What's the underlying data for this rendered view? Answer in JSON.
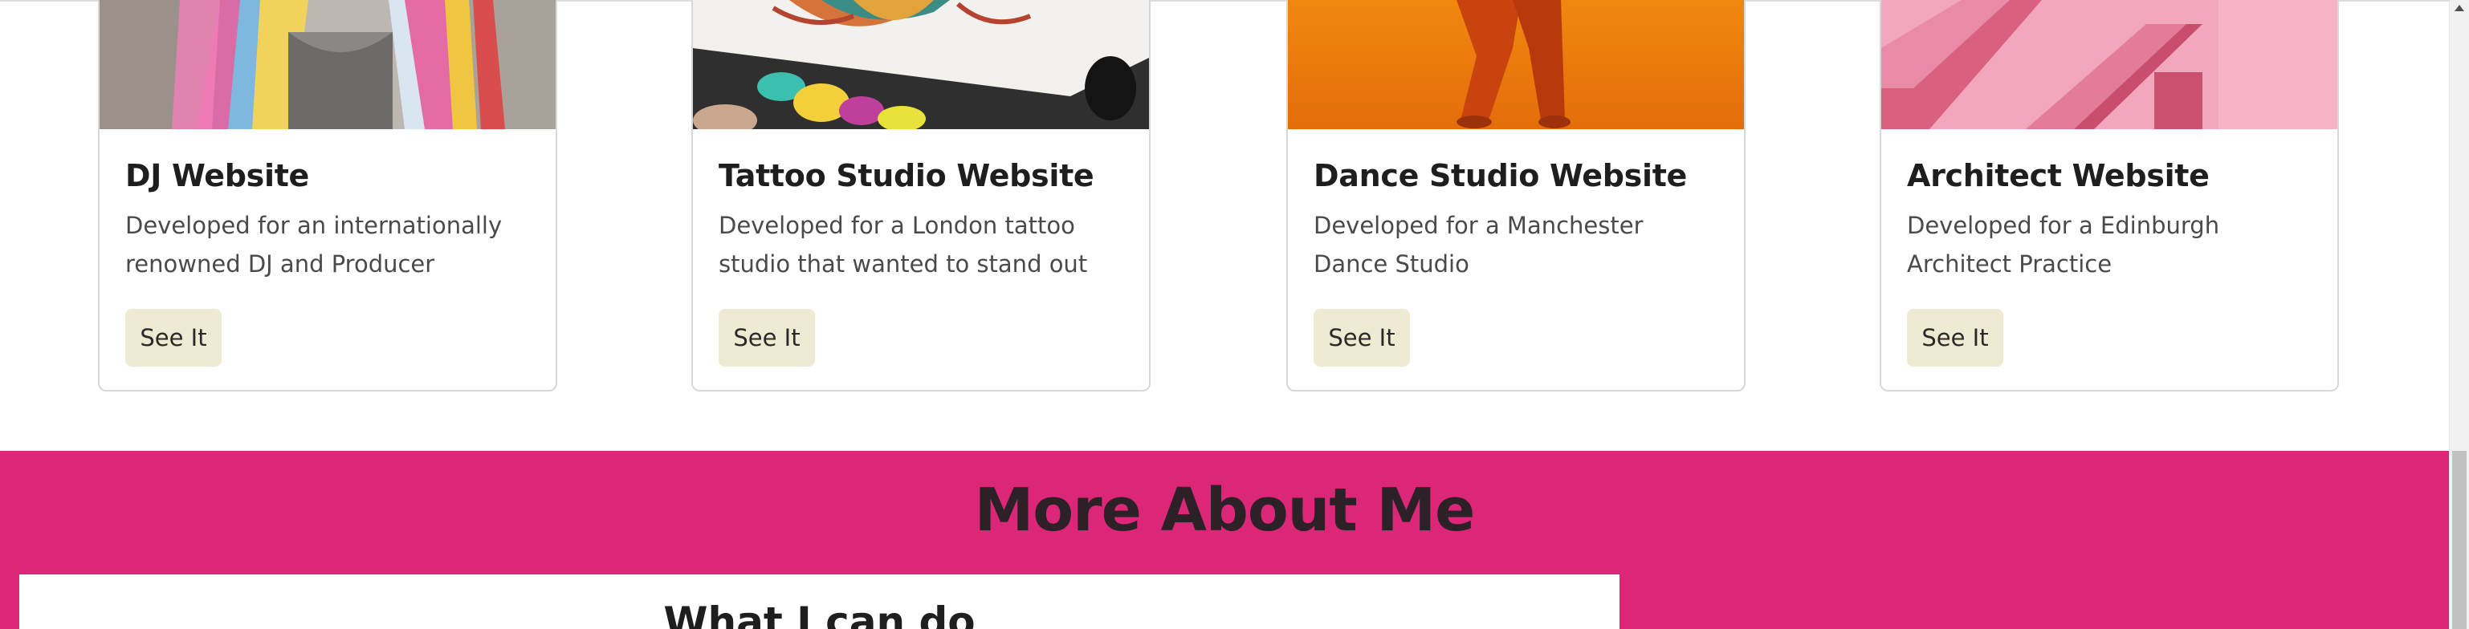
{
  "projects": [
    {
      "title": "DJ Website",
      "description": "Developed for an internationally renowned DJ and Producer",
      "button_label": "See It",
      "image_icon": "dj-photo"
    },
    {
      "title": "Tattoo Studio Website",
      "description": "Developed for a London tattoo studio that wanted to stand out",
      "button_label": "See It",
      "image_icon": "tattoo-photo"
    },
    {
      "title": "Dance Studio Website",
      "description": "Developed for a Manchester Dance Studio",
      "button_label": "See It",
      "image_icon": "dance-photo"
    },
    {
      "title": "Architect Website",
      "description": "Developed for a Edinburgh Architect Practice",
      "button_label": "See It",
      "image_icon": "architecture-photo"
    }
  ],
  "about": {
    "title": "More About Me",
    "panel_title": "What I can do"
  },
  "colors": {
    "accent_pink": "#dc2778",
    "button_bg": "#eeebd2",
    "title_text": "#1e1e1e",
    "body_text": "#4a4a4a"
  }
}
